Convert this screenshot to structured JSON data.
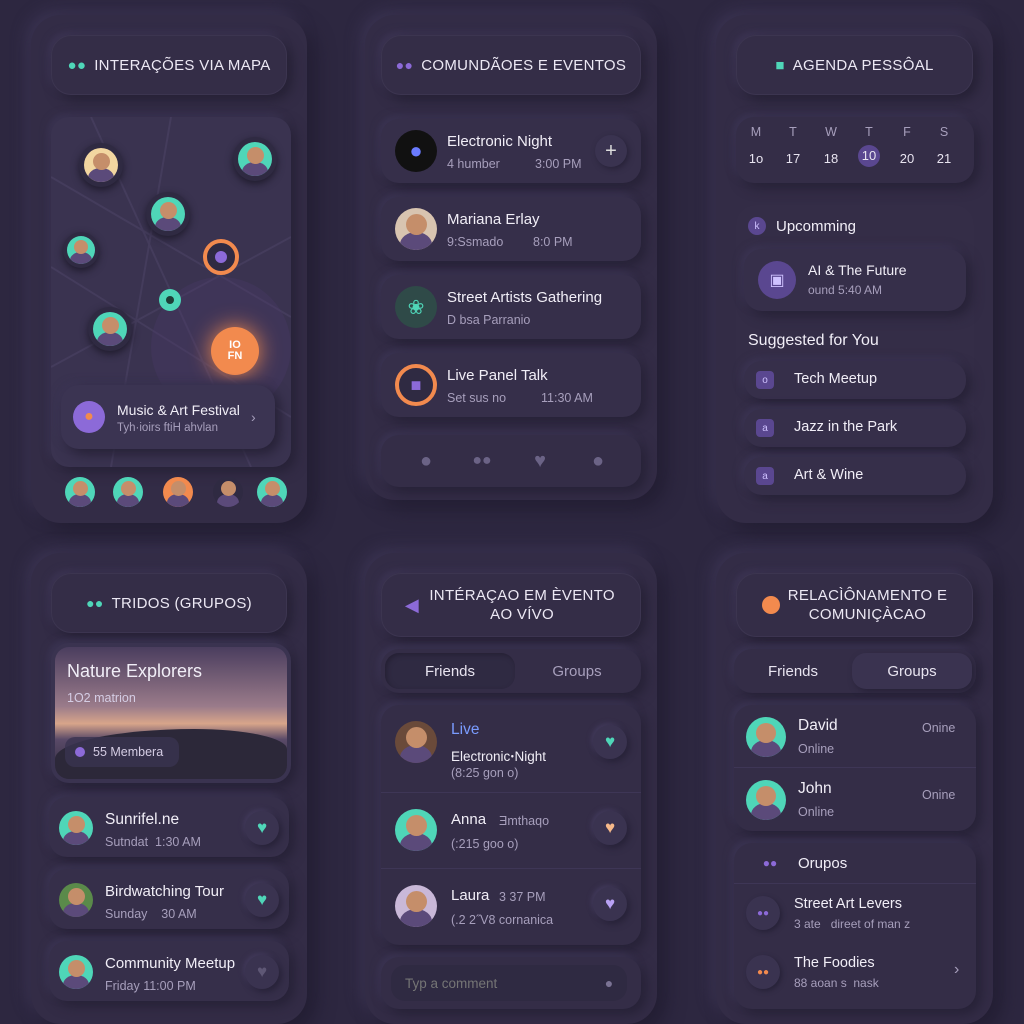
{
  "colors": {
    "background": "#2d2740",
    "panel": "#332c46",
    "teal": "#4fd6b8",
    "purple": "#8c6ad8",
    "orange": "#f28a4e",
    "blue": "#7a9cff"
  },
  "map": {
    "title": "INTERAÇÕES VIA MAPA",
    "header_icon": "people-icon",
    "pin_label": "IO\nFN",
    "event": {
      "title": "Music & Art Festival",
      "subtitle": "Tyh·ioirs ftiH ahvlan"
    }
  },
  "communities": {
    "title": "COMUNDÃOES E EVENTOS",
    "header_icon": "people-icon",
    "items": [
      {
        "title": "Electronic Night",
        "meta1": "4 humber",
        "meta2": "3:00 PM",
        "action": "+"
      },
      {
        "title": "Mariana Erlay",
        "meta1": "9:Ssmado",
        "meta2": "8:0 PM"
      },
      {
        "title": "Street Artists Gathering",
        "meta1": "D bsa Parranio",
        "meta2": ""
      },
      {
        "title": "Live Panel Talk",
        "meta1": "Set sus no",
        "meta2": "11:30 AM"
      }
    ],
    "nav_icons": [
      "person-icon",
      "group-icon",
      "heart-icon",
      "profile-icon"
    ]
  },
  "agenda": {
    "title": "AGENDA PESSÔAL",
    "header_icon": "calendar-icon",
    "days": [
      {
        "d": "M",
        "n": "1o"
      },
      {
        "d": "T",
        "n": "17"
      },
      {
        "d": "W",
        "n": "18"
      },
      {
        "d": "T",
        "n": "10"
      },
      {
        "d": "F",
        "n": "20"
      },
      {
        "d": "S",
        "n": "21"
      }
    ],
    "selected_index": 3,
    "upcoming_label": "Upcomming",
    "upcoming_icon": "k",
    "upcoming": {
      "title": "AI & The Future",
      "time": "ound 5:40 AM"
    },
    "suggested_label": "Suggested for You",
    "suggested": [
      {
        "icon": "o",
        "title": "Tech Meetup"
      },
      {
        "icon": "a",
        "title": "Jazz in the Park"
      },
      {
        "icon": "a",
        "title": "Art & Wine"
      }
    ]
  },
  "groups": {
    "title": "TRIDOS (GRUPOS)",
    "header_icon": "people-icon",
    "featured": {
      "title": "Nature Explorers",
      "subtitle": "1O2 matrion",
      "members": "55 Membera"
    },
    "items": [
      {
        "title": "Sunrifel.ne",
        "meta": "Sutndat  1:30 AM"
      },
      {
        "title": "Birdwatching Tour",
        "meta": "Sunday    30 AM"
      },
      {
        "title": "Community Meetup",
        "meta": "Friday 11:00 PM"
      }
    ]
  },
  "live": {
    "title": "INTÉRAÇAO EM ÈVENTO AO VÍVO",
    "header_icon": "speaker-icon",
    "tabs": [
      "Friends",
      "Groups"
    ],
    "items": [
      {
        "badge": "Live",
        "title": "ElectronicꞏNight",
        "meta": "(8:25 gon o)",
        "extra": ""
      },
      {
        "title": "Anna",
        "extra": "Ǝmthaqo",
        "meta": "(:215 goo o)"
      },
      {
        "title": "Laura",
        "extra": "3 37 PM",
        "meta": "(.2 2˝V8 cornanica"
      }
    ],
    "comment_placeholder": "Typ a comment"
  },
  "relations": {
    "title": "RELACÌÔNAMENTO E COMUNIÇÀCAO",
    "header_icon": "chat-icon",
    "tabs": [
      "Friends",
      "Groups"
    ],
    "friends": [
      {
        "name": "David",
        "status": "Online",
        "badge": "Onine"
      },
      {
        "name": "John",
        "status": "Online",
        "badge": "Onine"
      }
    ],
    "groups_label": "Orupos",
    "groups": [
      {
        "title": "Street Art Levers",
        "meta": "3 ate   direet of man z"
      },
      {
        "title": "The Foodies",
        "meta": "88 aoan s  nask"
      }
    ]
  }
}
